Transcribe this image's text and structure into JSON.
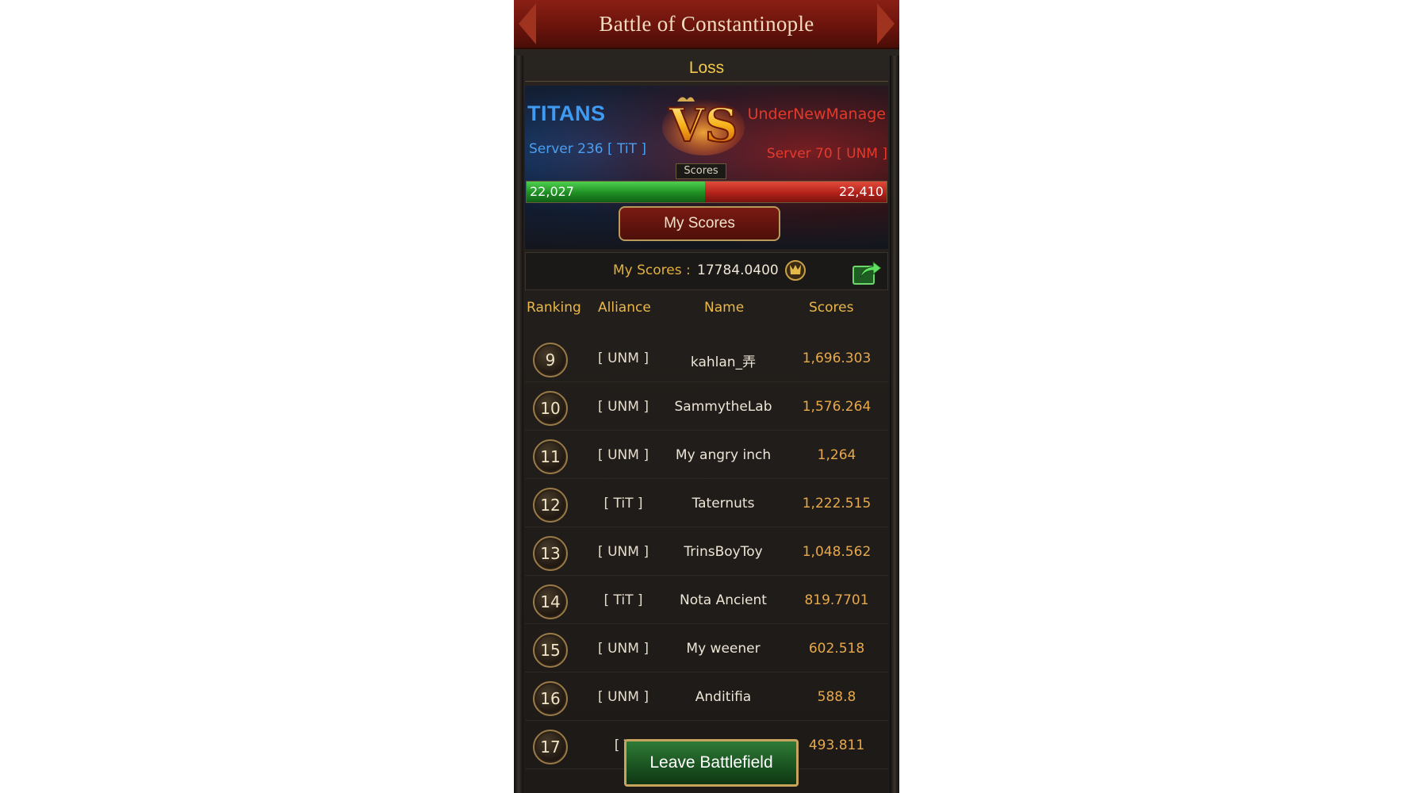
{
  "header": {
    "title": "Battle of Constantinople"
  },
  "result": "Loss",
  "versus": {
    "left_team": {
      "name": "TITANS",
      "server": "Server 236 [ TiT ]",
      "score": "22,027",
      "color": "#3f9bf2"
    },
    "right_team": {
      "name": "UnderNewManage",
      "server": "Server 70 [ UNM ]",
      "score": "22,410",
      "color": "#e03a2a"
    },
    "vs_text": "VS",
    "scores_label": "Scores",
    "left_share": 0.4957
  },
  "my_scores_tab": "My Scores",
  "my_scores": {
    "label": "My Scores :",
    "value": "17784.0400",
    "trophy_icon": "trophy-icon",
    "share_icon": "share-icon"
  },
  "table": {
    "columns": [
      "Ranking",
      "Alliance",
      "Name",
      "Scores"
    ],
    "rows": [
      {
        "rank": "9",
        "alliance": "[ UNM ]",
        "name": "kahlan_弄",
        "score": "1,696.303"
      },
      {
        "rank": "10",
        "alliance": "[ UNM ]",
        "name": "SammytheLab",
        "score": "1,576.264"
      },
      {
        "rank": "11",
        "alliance": "[ UNM ]",
        "name": "My angry inch",
        "score": "1,264"
      },
      {
        "rank": "12",
        "alliance": "[ TiT ]",
        "name": "Taternuts",
        "score": "1,222.515"
      },
      {
        "rank": "13",
        "alliance": "[ UNM ]",
        "name": "TrinsBoyToy",
        "score": "1,048.562"
      },
      {
        "rank": "14",
        "alliance": "[ TiT ]",
        "name": "Nota Ancient",
        "score": "819.7701"
      },
      {
        "rank": "15",
        "alliance": "[ UNM ]",
        "name": "My weener",
        "score": "602.518"
      },
      {
        "rank": "16",
        "alliance": "[ UNM ]",
        "name": "Anditifia",
        "score": "588.8"
      },
      {
        "rank": "17",
        "alliance": "[ T",
        "name": "",
        "score": "493.811"
      }
    ]
  },
  "leave_button": "Leave Battlefield"
}
